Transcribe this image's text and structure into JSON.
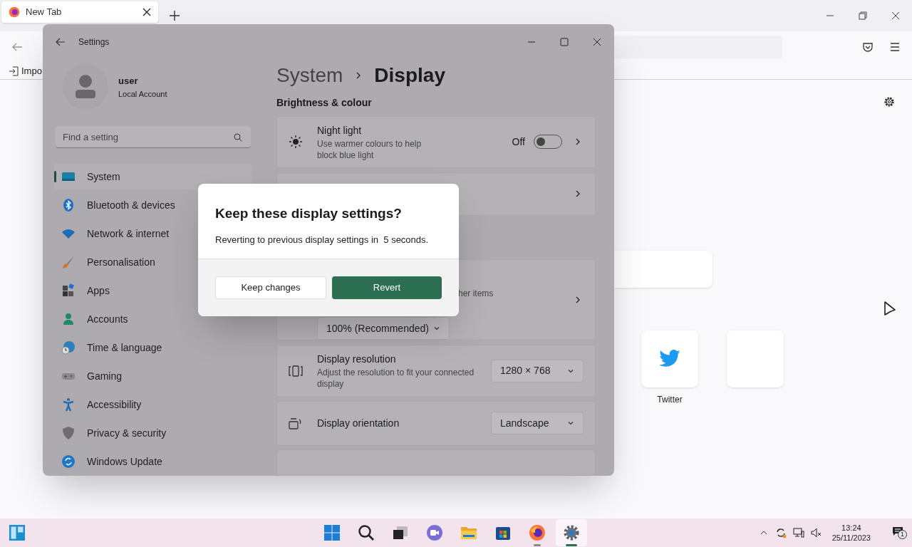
{
  "browser": {
    "tab": {
      "title": "New Tab",
      "selected": true
    },
    "bookmark": "Impo",
    "top_sites": [
      {
        "kind": "twitter",
        "label": "Twitter"
      },
      {
        "kind": "blank"
      }
    ]
  },
  "settings": {
    "title": "Settings",
    "user": {
      "name": "user",
      "account": "Local Account"
    },
    "search": {
      "placeholder": "Find a setting"
    },
    "nav": [
      {
        "kind": "system",
        "label": "System",
        "selected": true
      },
      {
        "kind": "bluetooth",
        "label": "Bluetooth & devices",
        "selected": false
      },
      {
        "kind": "network",
        "label": "Network & internet",
        "selected": false
      },
      {
        "kind": "personalisation",
        "label": "Personalisation",
        "selected": false
      },
      {
        "kind": "apps",
        "label": "Apps",
        "selected": false
      },
      {
        "kind": "accounts",
        "label": "Accounts",
        "selected": false
      },
      {
        "kind": "time",
        "label": "Time & language",
        "selected": false
      },
      {
        "kind": "gaming",
        "label": "Gaming",
        "selected": false
      },
      {
        "kind": "accessibility",
        "label": "Accessibility",
        "selected": false
      },
      {
        "kind": "privacy",
        "label": "Privacy & security",
        "selected": false
      },
      {
        "kind": "update",
        "label": "Windows Update",
        "selected": false
      }
    ],
    "breadcrumb": {
      "parent": "System",
      "current": "Display"
    },
    "section": "Brightness & colour",
    "night_light": {
      "title": "Night light",
      "description": "Use warmer colours to help block blue light",
      "state_label": "Off",
      "on": false
    },
    "scale": {
      "description_fragment": "her items",
      "value": "100% (Recommended)"
    },
    "resolution": {
      "title": "Display resolution",
      "description": "Adjust the resolution to fit your connected display",
      "value": "1280 × 768"
    },
    "orientation": {
      "title": "Display orientation",
      "value": "Landscape"
    }
  },
  "dialog": {
    "title": "Keep these display settings?",
    "message": "Reverting to previous display settings in  5 seconds.",
    "buttons": [
      {
        "kind": "secondary",
        "label": "Keep changes"
      },
      {
        "kind": "primary",
        "label": "Revert"
      }
    ]
  },
  "taskbar": {
    "apps": [
      {
        "kind": "windows",
        "running": false,
        "active": false
      },
      {
        "kind": "search",
        "running": false,
        "active": false
      },
      {
        "kind": "taskview",
        "running": false,
        "active": false
      },
      {
        "kind": "chat",
        "running": false,
        "active": false
      },
      {
        "kind": "files",
        "running": false,
        "active": false
      },
      {
        "kind": "store",
        "running": false,
        "active": false
      },
      {
        "kind": "firefox",
        "running": true,
        "active": false
      },
      {
        "kind": "settings",
        "running": true,
        "active": true
      }
    ],
    "time": "13:24",
    "date": "25/11/2023",
    "notifications": "1"
  }
}
